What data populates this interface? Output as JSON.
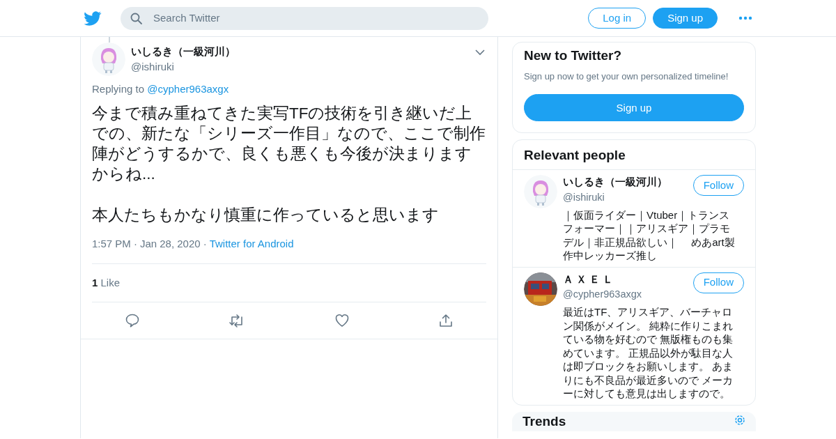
{
  "header": {
    "search": {
      "placeholder": "Search Twitter"
    },
    "buttons": [
      {
        "label": "Log in",
        "kind": "outline"
      },
      {
        "label": "Sign up",
        "kind": "solid"
      }
    ]
  },
  "tweet": {
    "name": "いしるき（一級河川）",
    "handle": "@ishiruki",
    "replying_label": "Replying to",
    "replying_to": "@cypher963axgx",
    "text": "今まで積み重ねてきた実写TFの技術を引き継いだ上での、新たな「シリーズ一作目」なので、ここで制作陣がどうするかで、良くも悪くも今後が決まりますからね...\n\n本人たちもかなり慎重に作っていると思います",
    "time": "1:57 PM",
    "separator": "·",
    "date": "Jan 28, 2020",
    "source": "Twitter for Android",
    "like_count": "1",
    "like_label": "Like"
  },
  "signup_card": {
    "title": "New to Twitter?",
    "subtitle": "Sign up now to get your own personalized timeline!",
    "button": "Sign up"
  },
  "relevant_people": {
    "title": "Relevant people",
    "people": [
      {
        "name": "いしるき（一級河川）",
        "handle": "@ishiruki",
        "bio": "｜仮面ライダー｜Vtuber｜トランスフォーマー｜｜アリスギア｜プラモデル｜非正規品欲しい｜　 めあart製作中レッカーズ推し",
        "follow": "Follow"
      },
      {
        "name": "Ａ Ｘ Ｅ Ｌ",
        "handle": "@cypher963axgx",
        "bio": "最近はTF、アリスギア、バーチャロン関係がメイン。 純粋に作りこまれている物を好むので 無版権ものも集めています。 正規品以外が駄目な人は即ブロックをお願いします。 あまりにも不良品が最近多いので メーカーに対しても意見は出しますので。",
        "follow": "Follow"
      }
    ]
  },
  "trends": {
    "title": "Trends"
  }
}
